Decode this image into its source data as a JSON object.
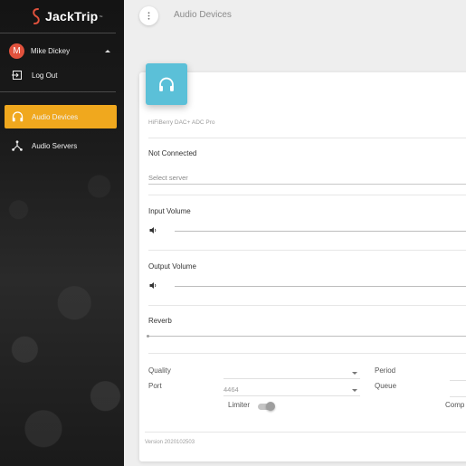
{
  "brand": {
    "name": "JackTrip",
    "trademark": "™",
    "accent": "#e1523d"
  },
  "user": {
    "initial": "M",
    "name": "Mike Dickey"
  },
  "sidebar": {
    "logout_label": "Log Out",
    "items": [
      {
        "label": "Audio Devices",
        "icon": "headphones-icon",
        "active": true
      },
      {
        "label": "Audio Servers",
        "icon": "network-icon",
        "active": false
      }
    ],
    "active_color": "#f0a81e"
  },
  "header": {
    "title": "Audio Devices"
  },
  "device": {
    "name": "HiFiBerry DAC+ ADC Pro",
    "icon_color": "#5bc0d8"
  },
  "connection": {
    "status": "Not Connected",
    "server_placeholder": "Select server"
  },
  "input_volume": {
    "label": "Input Volume",
    "icon": "volume-icon"
  },
  "output_volume": {
    "label": "Output Volume",
    "icon": "volume-icon"
  },
  "reverb": {
    "label": "Reverb"
  },
  "settings": {
    "quality_label": "Quality",
    "quality_value": "",
    "period_label": "Period",
    "port_label": "Port",
    "port_value": "4464",
    "queue_label": "Queue",
    "limiter_label": "Limiter",
    "comp_label": "Comp"
  },
  "footer": {
    "version": "Version 2020102503"
  }
}
